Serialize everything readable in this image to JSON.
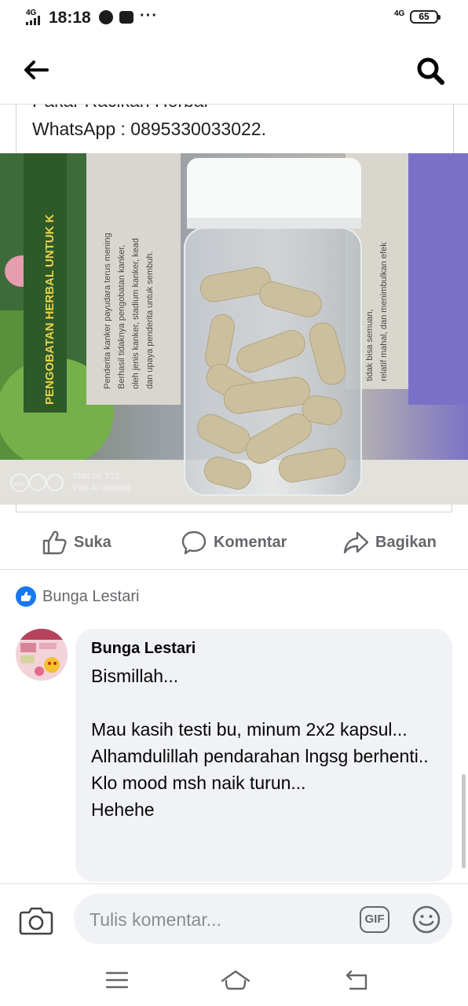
{
  "status_bar": {
    "network_left": "4G",
    "time": "18:18",
    "more": "···",
    "network_right": "4G",
    "battery": "65"
  },
  "post": {
    "cut_text": "Pakar Racikan Herbal",
    "whatsapp_line": "WhatsApp : 0895330033022.",
    "photo": {
      "book_side_text": "PENGOBATAN HERBAL UNTUK K",
      "book_paragraph": [
        "Penderita kanker payudara terus mening",
        "Berhasil tidaknya pengobatan kanker,",
        "oleh jenis kanker, stadium kanker, kead",
        "dan upaya penderita untuk sembuh."
      ],
      "book_right_text": [
        "tidak bisa semuan,",
        "relatif mahal, dan menimbulkan efek"
      ],
      "watermark_line1": "Shot on Y12",
      "watermark_line2": "Vivo AI camera",
      "watermark_badge": "vivo"
    }
  },
  "actions": {
    "like": "Suka",
    "comment": "Komentar",
    "share": "Bagikan"
  },
  "reaction": {
    "name": "Bunga Lestari"
  },
  "comment": {
    "author": "Bunga Lestari",
    "body": "Bismillah...\n\nMau kasih testi bu, minum 2x2 kapsul...\nAlhamdulillah pendarahan lngsg berhenti..\nKlo mood msh naik turun...\nHehehe"
  },
  "composer": {
    "placeholder": "Tulis komentar...",
    "gif_label": "GIF"
  },
  "colors": {
    "accent": "#1877f2",
    "muted_text": "#65676b",
    "bubble_bg": "#f0f2f5"
  },
  "icons": [
    "back-arrow-icon",
    "search-icon",
    "like-icon",
    "comment-icon",
    "share-icon",
    "camera-icon",
    "emoji-icon",
    "menu-icon",
    "home-icon",
    "back-icon"
  ]
}
